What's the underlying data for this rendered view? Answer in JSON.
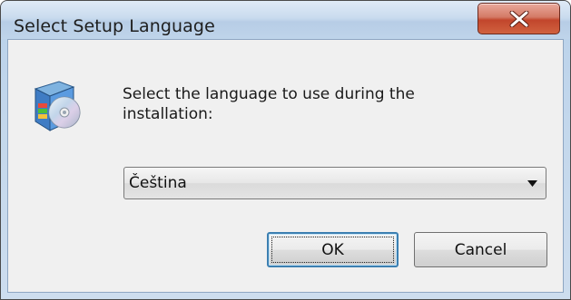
{
  "window": {
    "title": "Select Setup Language",
    "close_icon": "close-icon"
  },
  "dialog": {
    "icon": "setup-cd-icon",
    "prompt": "Select the language to use during the installation:",
    "language_select": {
      "value": "Čeština",
      "arrow_icon": "dropdown-arrow-icon"
    },
    "ok_label": "OK",
    "cancel_label": "Cancel"
  },
  "colors": {
    "close_button": "#c7472d",
    "title_bar": "#c4d8ee",
    "client_bg": "#f0f0f0",
    "ok_border": "#3c7fb1"
  }
}
